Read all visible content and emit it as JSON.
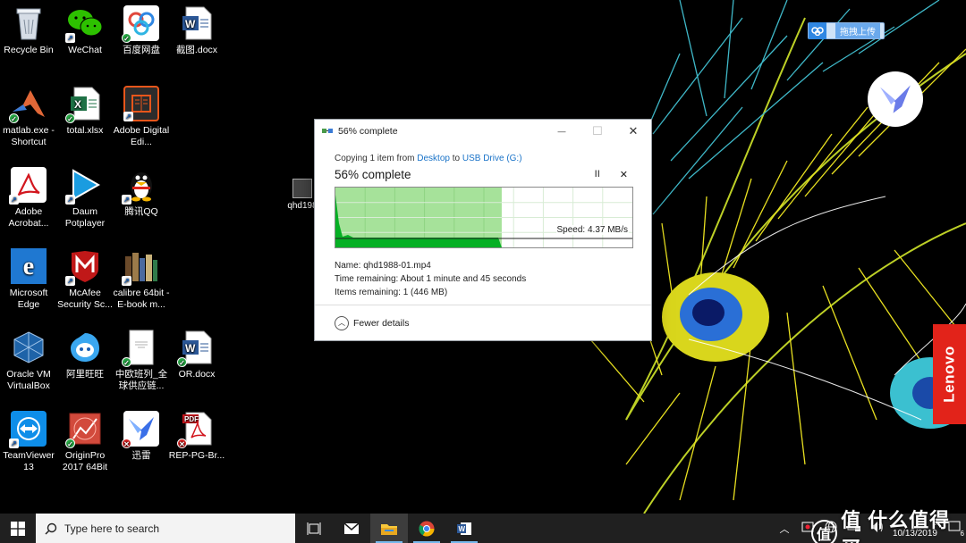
{
  "desktop_icons": [
    {
      "label": "Recycle Bin",
      "icon": "recycle-bin-icon",
      "color": "#c9d4e0"
    },
    {
      "label": "WeChat",
      "icon": "wechat-icon",
      "color": "#2dc100"
    },
    {
      "label": "百度网盘",
      "icon": "baidu-netdisk-icon",
      "color": "#ffffff"
    },
    {
      "label": "截图.docx",
      "icon": "word-doc-icon",
      "color": "#ffffff"
    },
    {
      "label": "matlab.exe - Shortcut",
      "icon": "matlab-icon",
      "color": "#e16737"
    },
    {
      "label": "total.xlsx",
      "icon": "excel-icon",
      "color": "#ffffff"
    },
    {
      "label": "Adobe Digital Edi...",
      "icon": "adobe-digital-editions-icon",
      "color": "#e8561b"
    },
    {
      "label": "Adobe Acrobat...",
      "icon": "adobe-acrobat-icon",
      "color": "#ffffff"
    },
    {
      "label": "Daum Potplayer",
      "icon": "potplayer-icon",
      "color": "#1a9ce0"
    },
    {
      "label": "腾讯QQ",
      "icon": "qq-penguin-icon",
      "color": "#000000"
    },
    {
      "label": "Microsoft Edge",
      "icon": "edge-icon",
      "color": "#1f78d1"
    },
    {
      "label": "McAfee Security Sc...",
      "icon": "mcafee-icon",
      "color": "#c01818"
    },
    {
      "label": "calibre 64bit - E-book m...",
      "icon": "calibre-icon",
      "color": "#6b4a2a"
    },
    {
      "label": "Oracle VM VirtualBox",
      "icon": "virtualbox-icon",
      "color": "#1e63a8"
    },
    {
      "label": "阿里旺旺",
      "icon": "aliwangwang-icon",
      "color": "#3aa7f0"
    },
    {
      "label": "中欧班列_全球供应链...",
      "icon": "pdf-page-icon",
      "color": "#ffffff"
    },
    {
      "label": "OR.docx",
      "icon": "word-doc-icon",
      "color": "#ffffff"
    },
    {
      "label": "TeamViewer 13",
      "icon": "teamviewer-icon",
      "color": "#0e8ee9"
    },
    {
      "label": "OriginPro 2017 64Bit",
      "icon": "originpro-icon",
      "color": "#d24a3c"
    },
    {
      "label": "迅雷",
      "icon": "xunlei-bird-icon",
      "color": "#ffffff"
    },
    {
      "label": "REP-PG-Br...",
      "icon": "pdf-file-icon",
      "color": "#ffffff"
    }
  ],
  "drag_ghost": {
    "label": "qhd198"
  },
  "dialog": {
    "title": "56% complete",
    "copy_prefix": "Copying 1 item from ",
    "source": "Desktop",
    "copy_middle": " to ",
    "destination": "USB Drive (G:)",
    "heading": "56% complete",
    "pause_label": "II",
    "close_label": "✕",
    "progress": 0.56,
    "speed_label": "Speed: 4.37 MB/s",
    "name_line": "Name:  qhd1988-01.mp4",
    "time_line": "Time remaining:  About 1 minute and 45 seconds",
    "items_line": "Items remaining:  1 (446 MB)",
    "fewer_details": "Fewer details",
    "minimize": "—",
    "maximize": "☐",
    "close": "✕",
    "accent": "#06b025",
    "fill_light": "#a6e29a"
  },
  "baidu_widget": {
    "label": "拖拽上传"
  },
  "lenovo": {
    "label": "Lenovo"
  },
  "taskbar": {
    "search_placeholder": "Type here to search",
    "apps": [
      "task-view-icon",
      "mail-icon",
      "file-explorer-icon",
      "chrome-icon",
      "word-icon"
    ],
    "tray_icons": [
      "chevron-up-icon",
      "screen-capture-icon",
      "globe-icon",
      "network-icon",
      "volume-icon"
    ],
    "time": "0",
    "date": "10/13/2019",
    "notifications": "6"
  },
  "watermark": {
    "text": "值 什么值得买"
  }
}
